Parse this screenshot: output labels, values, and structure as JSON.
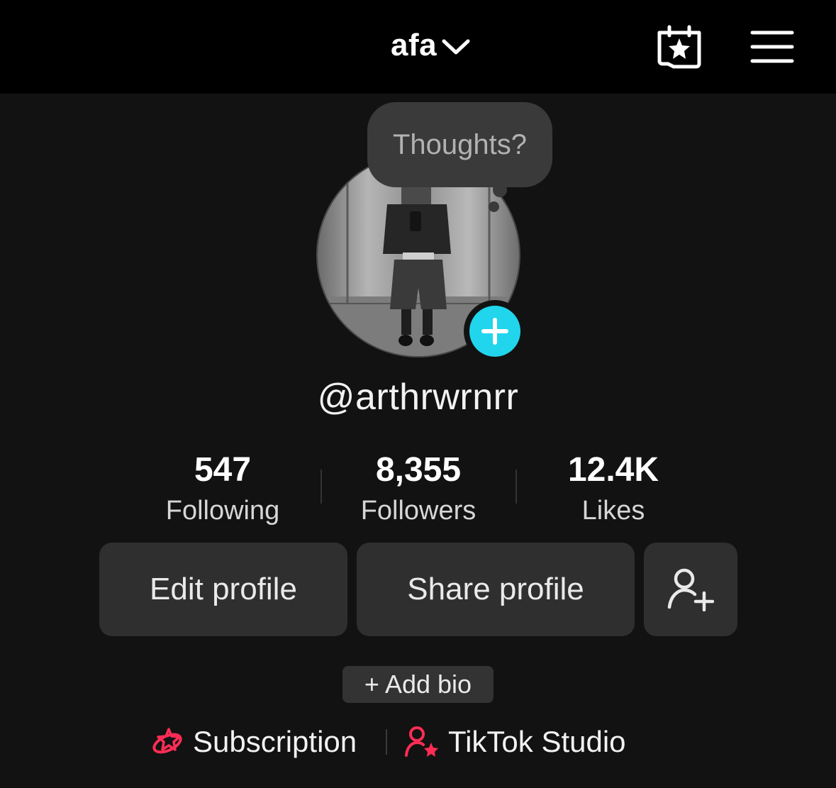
{
  "header": {
    "account_name": "afa",
    "icons": {
      "switch": "chevron-down-icon",
      "calendar": "calendar-star-icon",
      "menu": "hamburger-menu-icon"
    }
  },
  "profile": {
    "thought_bubble": "Thoughts?",
    "username": "@arthrwrnrr",
    "add_icon": "plus-icon"
  },
  "stats": [
    {
      "value": "547",
      "label": "Following"
    },
    {
      "value": "8,355",
      "label": "Followers"
    },
    {
      "value": "12.4K",
      "label": "Likes"
    }
  ],
  "actions": {
    "edit_profile": "Edit profile",
    "share_profile": "Share profile",
    "add_friend_icon": "add-user-icon"
  },
  "bio": {
    "add_bio": "+ Add bio"
  },
  "links": [
    {
      "label": "Subscription",
      "icon": "subscription-icon"
    },
    {
      "label": "TikTok Studio",
      "icon": "studio-user-star-icon"
    }
  ],
  "colors": {
    "accent_cyan": "#20d5ec",
    "accent_pink": "#fe2c55",
    "background": "#121212",
    "header": "#000000"
  }
}
